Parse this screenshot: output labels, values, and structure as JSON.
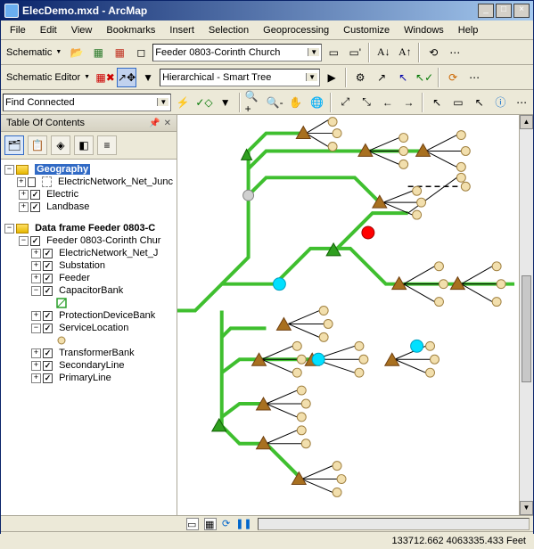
{
  "window": {
    "title": "ElecDemo.mxd - ArcMap"
  },
  "menu": {
    "file": "File",
    "edit": "Edit",
    "view": "View",
    "bookmarks": "Bookmarks",
    "insert": "Insert",
    "selection": "Selection",
    "geoprocessing": "Geoprocessing",
    "customize": "Customize",
    "windows": "Windows",
    "help": "Help"
  },
  "toolbar1": {
    "schematic": "Schematic",
    "feeder_combo": "Feeder 0803-Corinth Church"
  },
  "toolbar2": {
    "schematic_editor": "Schematic Editor",
    "layout_combo": "Hierarchical - Smart Tree"
  },
  "toolbar3": {
    "find_combo": "Find Connected"
  },
  "toc": {
    "title": "Table Of Contents",
    "geography": "Geography",
    "enj": "ElectricNetwork_Net_Junc",
    "electric": "Electric",
    "landbase": "Landbase",
    "dataframe": "Data frame Feeder 0803-C",
    "feeder_root": "Feeder 0803-Corinth Chur",
    "enj2": "ElectricNetwork_Net_J",
    "substation": "Substation",
    "feeder": "Feeder",
    "capacitor": "CapacitorBank",
    "protection": "ProtectionDeviceBank",
    "service": "ServiceLocation",
    "transformer": "TransformerBank",
    "secondary": "SecondaryLine",
    "primary": "PrimaryLine"
  },
  "status": {
    "coords": "133712.662 4063335.433 Feet"
  }
}
